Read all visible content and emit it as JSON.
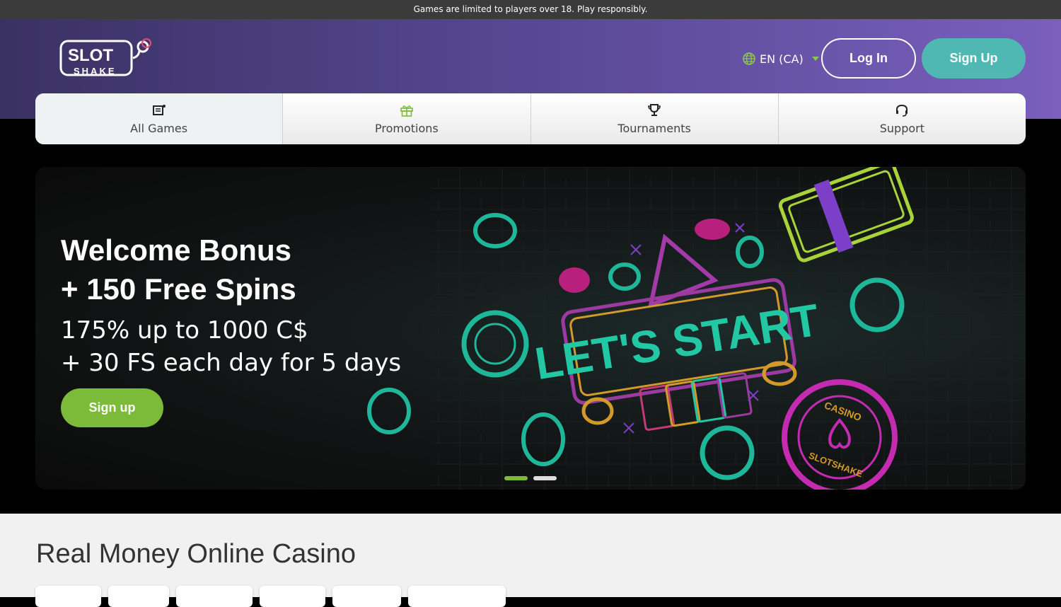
{
  "notice": "Games are limited to players over 18. Play responsibly.",
  "header": {
    "logo_text_top": "SLOT",
    "logo_text_bottom": "SHAKE",
    "language": "EN (CA)",
    "login_label": "Log In",
    "signup_label": "Sign Up"
  },
  "nav": {
    "items": [
      {
        "label": "All Games",
        "icon": "games-icon"
      },
      {
        "label": "Promotions",
        "icon": "gift-icon"
      },
      {
        "label": "Tournaments",
        "icon": "trophy-icon"
      },
      {
        "label": "Support",
        "icon": "headset-icon"
      }
    ]
  },
  "hero": {
    "title_line1": "Welcome Bonus",
    "title_line2": "+ 150 Free Spins",
    "sub_line1": "175% up to 1000 C$",
    "sub_line2": "+ 30 FS each day for 5 days",
    "button_label": "Sign up",
    "art_text": "LET'S START",
    "chip_text_top": "CASINO",
    "chip_text_bottom": "SLOTSHAKE",
    "slides": 2,
    "active_slide": 1
  },
  "section": {
    "title": "Real Money Online Casino"
  },
  "colors": {
    "accent_green": "#7cba3a",
    "teal": "#4fb8b2",
    "purple": "#54468f"
  }
}
